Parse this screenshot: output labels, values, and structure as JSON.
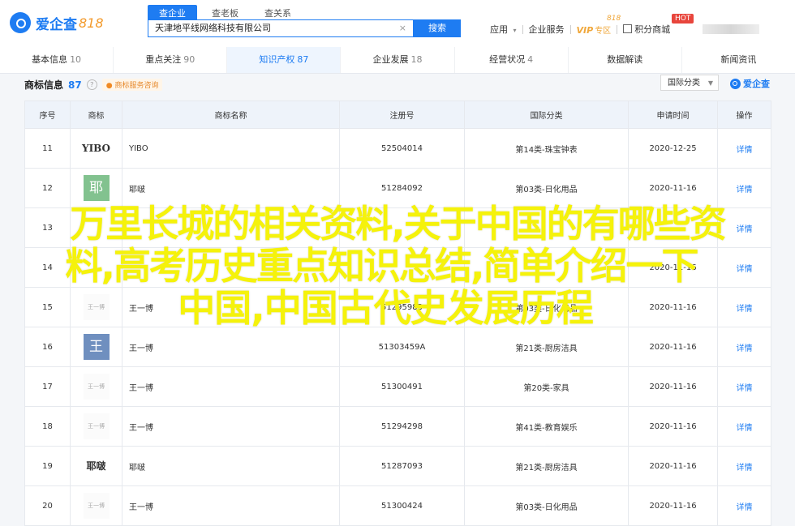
{
  "header": {
    "logo_text": "爱企查",
    "logo_num": "818",
    "search_tabs": [
      "查企业",
      "查老板",
      "查关系"
    ],
    "search_value": "天津地平线网络科技有限公司",
    "search_clear": "×",
    "search_button": "搜索",
    "nav": {
      "app": "应用",
      "app_caret": "▾",
      "service": "企业服务",
      "vip": "VIP",
      "vip_sub": "专区",
      "vip_top": "818",
      "points": "积分商城",
      "hot": "HOT"
    }
  },
  "dimension_tabs": [
    {
      "label": "基本信息",
      "count": "10"
    },
    {
      "label": "重点关注",
      "count": "90"
    },
    {
      "label": "知识产权",
      "count": "87"
    },
    {
      "label": "企业发展",
      "count": "18"
    },
    {
      "label": "经营状况",
      "count": "4"
    },
    {
      "label": "数据解读",
      "count": ""
    },
    {
      "label": "新闻资讯",
      "count": ""
    }
  ],
  "section": {
    "title": "商标信息",
    "count": "87",
    "help": "?",
    "consult": "商标服务咨询",
    "classification": "国际分类",
    "brand": "爱企查"
  },
  "table": {
    "headers": [
      "序号",
      "商标",
      "商标名称",
      "注册号",
      "国际分类",
      "申请时间",
      "操作"
    ],
    "rows": [
      {
        "no": "11",
        "mark": "YIBO",
        "name": "YIBO",
        "reg": "52504014",
        "cls": "第14类-珠宝钟表",
        "date": "2020-12-25",
        "op": "详情"
      },
      {
        "no": "12",
        "mark": "耶",
        "name": "耶啵",
        "reg": "51284092",
        "cls": "第03类-日化用品",
        "date": "2020-11-16",
        "op": "详情"
      },
      {
        "no": "13",
        "mark": "",
        "name": "",
        "reg": "",
        "cls": "",
        "date": "",
        "op": "详情"
      },
      {
        "no": "14",
        "mark": "",
        "name": "",
        "reg": "",
        "cls": "",
        "date": "2020-11-16",
        "op": "详情"
      },
      {
        "no": "15",
        "mark": "王一博",
        "name": "王一博",
        "reg": "51295983",
        "cls": "第03类-日化用品",
        "date": "2020-11-16",
        "op": "详情"
      },
      {
        "no": "16",
        "mark": "王",
        "name": "王一博",
        "reg": "51303459A",
        "cls": "第21类-厨房洁具",
        "date": "2020-11-16",
        "op": "详情"
      },
      {
        "no": "17",
        "mark": "王一博",
        "name": "王一博",
        "reg": "51300491",
        "cls": "第20类-家具",
        "date": "2020-11-16",
        "op": "详情"
      },
      {
        "no": "18",
        "mark": "王一博",
        "name": "王一博",
        "reg": "51294298",
        "cls": "第41类-教育娱乐",
        "date": "2020-11-16",
        "op": "详情"
      },
      {
        "no": "19",
        "mark": "耶啵",
        "name": "耶啵",
        "reg": "51287093",
        "cls": "第21类-厨房洁具",
        "date": "2020-11-16",
        "op": "详情"
      },
      {
        "no": "20",
        "mark": "王一博",
        "name": "王一博",
        "reg": "51300424",
        "cls": "第03类-日化用品",
        "date": "2020-11-16",
        "op": "详情"
      }
    ]
  },
  "overlay": {
    "line1": "万里长城的相关资料,关于中国的有哪些资",
    "line2": "料,高考历史重点知识总结,简单介绍一下",
    "line3": "中国,中国古代史发展历程"
  }
}
